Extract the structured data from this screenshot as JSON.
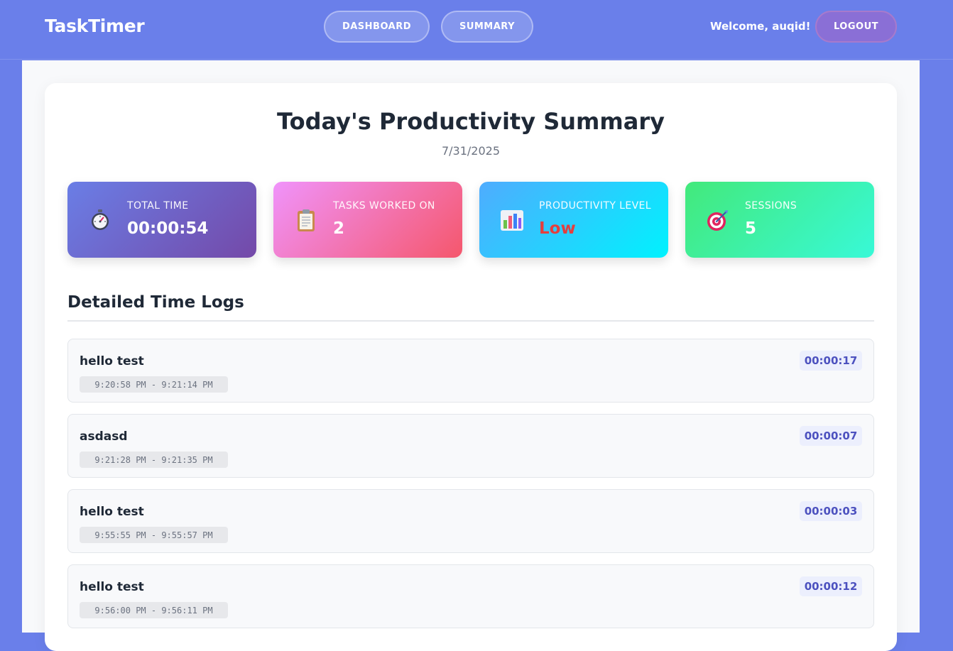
{
  "header": {
    "brand": "TaskTimer",
    "nav": {
      "dashboard": "DASHBOARD",
      "summary": "SUMMARY"
    },
    "welcome": "Welcome, auqid!",
    "logout": "LOGOUT"
  },
  "summary": {
    "title": "Today's Productivity Summary",
    "date": "7/31/2025",
    "stats": [
      {
        "icon": "stopwatch-icon",
        "label": "TOTAL TIME",
        "value": "00:00:54"
      },
      {
        "icon": "clipboard-icon",
        "label": "TASKS WORKED ON",
        "value": "2"
      },
      {
        "icon": "bar-chart-icon",
        "label": "PRODUCTIVITY LEVEL",
        "value": "Low",
        "value_color": "#e53e3e"
      },
      {
        "icon": "target-icon",
        "label": "SESSIONS",
        "value": "5"
      }
    ]
  },
  "logs": {
    "title": "Detailed Time Logs",
    "items": [
      {
        "task": "hello test",
        "range": "9:20:58 PM - 9:21:14 PM",
        "duration": "00:00:17"
      },
      {
        "task": "asdasd",
        "range": "9:21:28 PM - 9:21:35 PM",
        "duration": "00:00:07"
      },
      {
        "task": "hello test",
        "range": "9:55:55 PM - 9:55:57 PM",
        "duration": "00:00:03"
      },
      {
        "task": "hello test",
        "range": "9:56:00 PM - 9:56:11 PM",
        "duration": "00:00:12"
      }
    ]
  },
  "colors": {
    "background": "#6a7fea",
    "accent": "#4c51bf",
    "low_level": "#e53e3e"
  }
}
